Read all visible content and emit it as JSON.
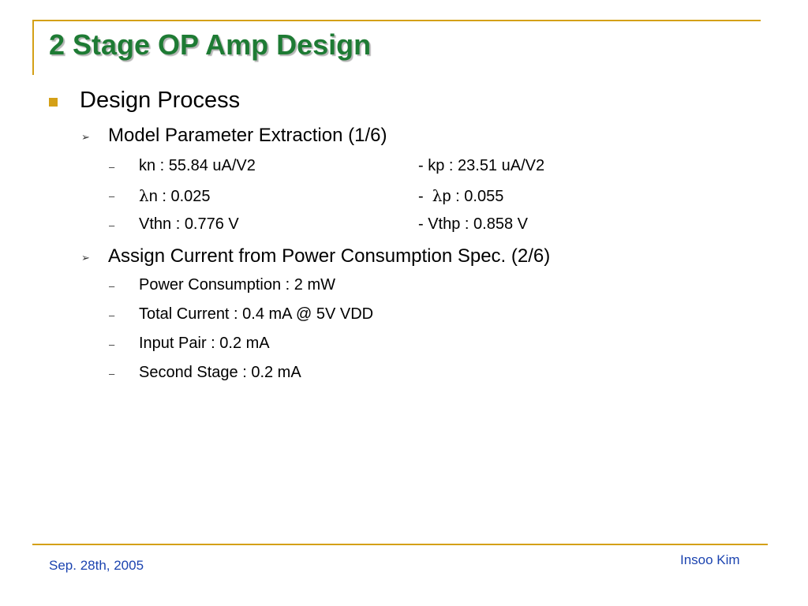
{
  "slide": {
    "title": "2 Stage OP Amp Design",
    "section": "Design Process",
    "subsections": [
      {
        "label": "Model Parameter Extraction (1/6)",
        "items": [
          {
            "left": "kn : 55.84 uA/V2",
            "right": "-  kp : 23.51 uA/V2"
          },
          {
            "left_symbol": "λ",
            "left": "n : 0.025",
            "right_prefix": "-  ",
            "right_symbol": "λ",
            "right": "p : 0.055"
          },
          {
            "left": "Vthn : 0.776 V",
            "right": "- Vthp : 0.858 V"
          }
        ]
      },
      {
        "label": "Assign Current from Power Consumption Spec. (2/6)",
        "items": [
          {
            "left": "Power Consumption : 2 mW"
          },
          {
            "left": "Total Current : 0.4 mA @ 5V VDD"
          },
          {
            "left": "Input Pair : 0.2 mA"
          },
          {
            "left": "Second Stage : 0.2 mA"
          }
        ]
      }
    ],
    "arrow_glyph": "➢",
    "dash_glyph": "–"
  },
  "footer": {
    "date": "Sep. 28th, 2005",
    "author": "Insoo Kim"
  },
  "colors": {
    "accent_gold": "#d4a017",
    "title_green": "#1e7b34",
    "footer_blue": "#1c44b0"
  }
}
